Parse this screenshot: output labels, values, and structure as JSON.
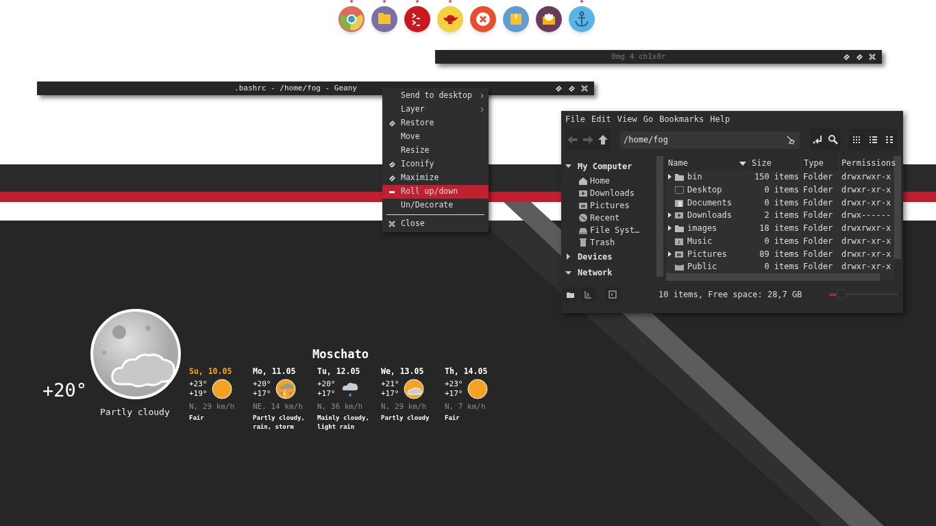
{
  "dock": [
    {
      "kind": "chrome",
      "running": true
    },
    {
      "kind": "files",
      "running": true
    },
    {
      "kind": "terminal",
      "running": true
    },
    {
      "kind": "lamp",
      "running": true
    },
    {
      "kind": "close",
      "running": false
    },
    {
      "kind": "package",
      "running": false
    },
    {
      "kind": "mail",
      "running": false
    },
    {
      "kind": "anchor",
      "running": true
    }
  ],
  "windows": [
    {
      "title": "0mg 4 ch1x0r",
      "focused": false
    },
    {
      "title": ".bashrc - /home/fog - Geany",
      "focused": true
    }
  ],
  "context_menu": {
    "items": [
      {
        "kind": "submenu",
        "label": "Send to desktop",
        "selected": false
      },
      {
        "kind": "submenu",
        "label": "Layer",
        "selected": false
      },
      {
        "kind": "diamond",
        "label": "Restore",
        "selected": false
      },
      {
        "kind": "plain",
        "label": "Move",
        "selected": false
      },
      {
        "kind": "plain",
        "label": "Resize",
        "selected": false
      },
      {
        "kind": "diamond",
        "label": "Iconify",
        "selected": false
      },
      {
        "kind": "diamond",
        "label": "Maximize",
        "selected": false
      },
      {
        "kind": "minus",
        "label": "Roll up/down",
        "selected": true
      },
      {
        "kind": "plain",
        "label": "Un/Decorate",
        "selected": false
      },
      {
        "kind": "separator"
      },
      {
        "kind": "close",
        "label": "Close",
        "selected": false
      }
    ]
  },
  "file_manager": {
    "menu": [
      "File",
      "Edit",
      "View",
      "Go",
      "Bookmarks",
      "Help"
    ],
    "path": "/home/fog",
    "sidebar": [
      {
        "label": "My Computer",
        "expanded": true,
        "children": [
          {
            "label": "Home",
            "kind": "home"
          },
          {
            "label": "Downloads",
            "kind": "download"
          },
          {
            "label": "Pictures",
            "kind": "picture"
          },
          {
            "label": "Recent",
            "kind": "clock"
          },
          {
            "label": "File Syst…",
            "kind": "drive"
          },
          {
            "label": "Trash",
            "kind": "trash"
          }
        ]
      },
      {
        "label": "Devices",
        "expanded": false
      },
      {
        "label": "Network",
        "expanded": true
      }
    ],
    "columns": [
      {
        "label": "Name",
        "sorted": true
      },
      {
        "label": "Size",
        "sorted": false
      },
      {
        "label": "Type",
        "sorted": false
      },
      {
        "label": "Permissions",
        "sorted": false
      }
    ],
    "rows": [
      {
        "name": "bin",
        "size": "150 items",
        "type": "Folder",
        "permissions": "drwxrwxr-x",
        "has_children": true,
        "kind": "folder"
      },
      {
        "name": "Desktop",
        "size": "0 items",
        "type": "Folder",
        "permissions": "drwxr-xr-x",
        "has_children": false,
        "kind": "desktop"
      },
      {
        "name": "Documents",
        "size": "0 items",
        "type": "Folder",
        "permissions": "drwxr-xr-x",
        "has_children": false,
        "kind": "documents"
      },
      {
        "name": "Downloads",
        "size": "2 items",
        "type": "Folder",
        "permissions": "drwx------",
        "has_children": true,
        "kind": "download"
      },
      {
        "name": "images",
        "size": "18 items",
        "type": "Folder",
        "permissions": "drwxrwxr-x",
        "has_children": true,
        "kind": "folder"
      },
      {
        "name": "Music",
        "size": "0 items",
        "type": "Folder",
        "permissions": "drwxr-xr-x",
        "has_children": false,
        "kind": "music"
      },
      {
        "name": "Pictures",
        "size": "89 items",
        "type": "Folder",
        "permissions": "drwxr-xr-x",
        "has_children": true,
        "kind": "picture"
      },
      {
        "name": "Public",
        "size": "0 items",
        "type": "Folder",
        "permissions": "drwxr-xr-x",
        "has_children": false,
        "kind": "public"
      }
    ],
    "status": "10 items, Free space: 28,7 GB",
    "zoom": {
      "level": 0.1
    }
  },
  "weather": {
    "temperature": "+20°",
    "condition": "Partly cloudy",
    "city": "Moschato",
    "days": [
      {
        "date": "Su, 10.05",
        "high": "+23°",
        "low": "+19°",
        "wind": "N, 29 km/h",
        "forecast": "Fair",
        "kind": "sun",
        "selected": true
      },
      {
        "date": "Mo, 11.05",
        "high": "+20°",
        "low": "+17°",
        "wind": "NE, 14 km/h",
        "forecast": "Partly cloudy, rain, storm",
        "kind": "storm",
        "selected": false
      },
      {
        "date": "Tu, 12.05",
        "high": "+20°",
        "low": "+17°",
        "wind": "N, 36 km/h",
        "forecast": "Mainly cloudy, light rain",
        "kind": "rain",
        "selected": false
      },
      {
        "date": "We, 13.05",
        "high": "+21°",
        "low": "+17°",
        "wind": "N, 29 km/h",
        "forecast": "Partly cloudy",
        "kind": "sun-cloud",
        "selected": false
      },
      {
        "date": "Th, 14.05",
        "high": "+23°",
        "low": "+17°",
        "wind": "N, 7 km/h",
        "forecast": "Fair",
        "kind": "sun",
        "selected": false
      }
    ]
  }
}
